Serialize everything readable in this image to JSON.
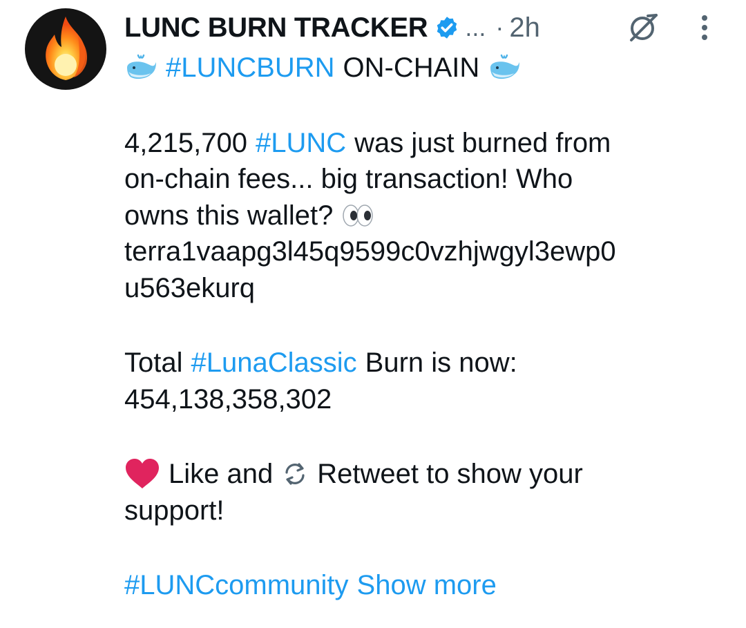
{
  "author": {
    "display_name": "LUNC BURN TRACKER",
    "truncation": "...",
    "separator": "·",
    "timestamp": "2h",
    "avatar_icon": "fire-icon",
    "verified_icon": "verified-badge-icon",
    "verified_color": "#1d9bf0"
  },
  "actions": {
    "grok_icon": "grok-icon",
    "more_icon": "more-vertical-icon"
  },
  "tweet": {
    "headline": {
      "tag": "#LUNCBURN",
      "text": "ON-CHAIN",
      "emoji": "whale-icon"
    },
    "burn_amount": "4,215,700",
    "burn_tag": "#LUNC",
    "line1_rest": "was just burned from",
    "line2": "on-chain fees... big transaction! Who",
    "line3": "owns this wallet?",
    "eyes_emoji": "eyes-icon",
    "wallet_line1": "terra1vaapg3l45q9599c0vzhjwgyl3ewp0",
    "wallet_line2": "u563ekurq",
    "total_prefix": "Total",
    "total_tag": "#LunaClassic",
    "total_suffix": "Burn is now:",
    "total_amount": "454,138,358,302",
    "cta_like": "Like and",
    "cta_retweet": "Retweet to show your",
    "cta_end": "support!",
    "heart_emoji": "red-heart-icon",
    "retweet_emoji": "retweet-arrows-icon",
    "community_tag": "#LUNCcommunity",
    "show_more": "Show more"
  },
  "colors": {
    "link": "#1d9bf0",
    "text": "#0f1419",
    "muted": "#536471",
    "heart": "#e0245e"
  }
}
